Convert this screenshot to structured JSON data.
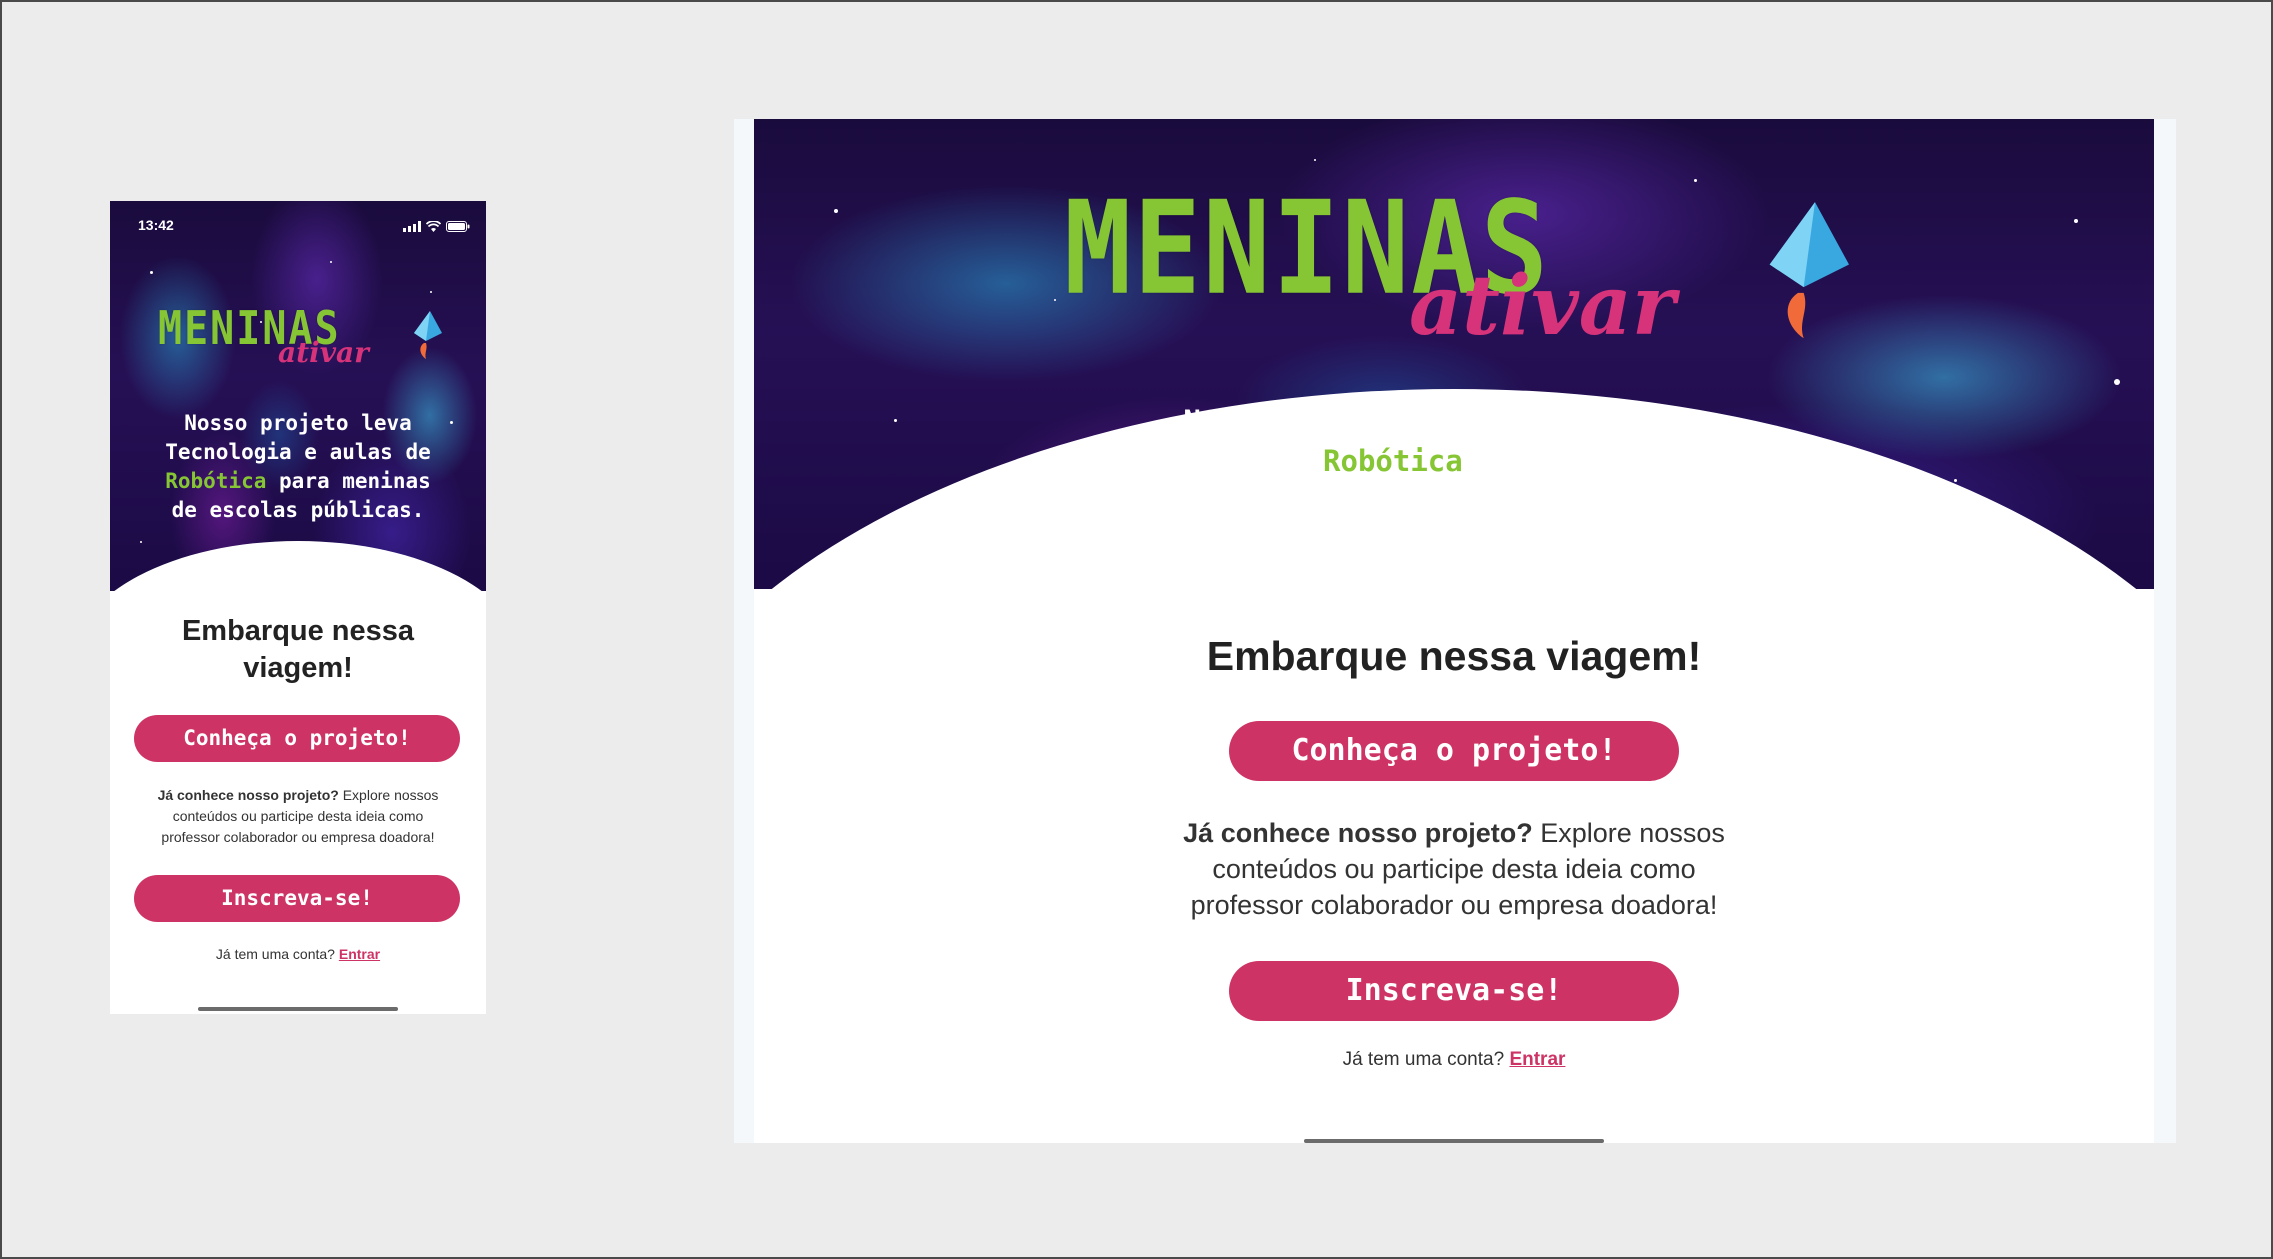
{
  "colors": {
    "accent_green": "#86c534",
    "brand_pink": "#cd3364",
    "space_dark": "#1a0b3d"
  },
  "brand": {
    "word": "MENINAS",
    "sub": "ativar"
  },
  "intro": {
    "line_start": "Nosso projeto leva Tecnologia e aulas de ",
    "highlight": "Robótica",
    "line_end": " para meninas de escolas públicas."
  },
  "cta": {
    "heading": "Embarque nessa viagem!",
    "primary_button": "Conheça o projeto!",
    "description_bold": "Já conhece nosso projeto?",
    "description_rest": " Explore nossos conteúdos ou participe desta ideia como professor colaborador ou empresa doadora!",
    "secondary_button": "Inscreva-se!",
    "login_prompt": "Já tem uma conta?",
    "login_link": "Entrar"
  },
  "phone": {
    "status_time": "13:42",
    "icons": [
      "signal-icon",
      "wifi-icon",
      "battery-icon"
    ]
  },
  "icons": {
    "logo_mark": "rocket-icon"
  }
}
